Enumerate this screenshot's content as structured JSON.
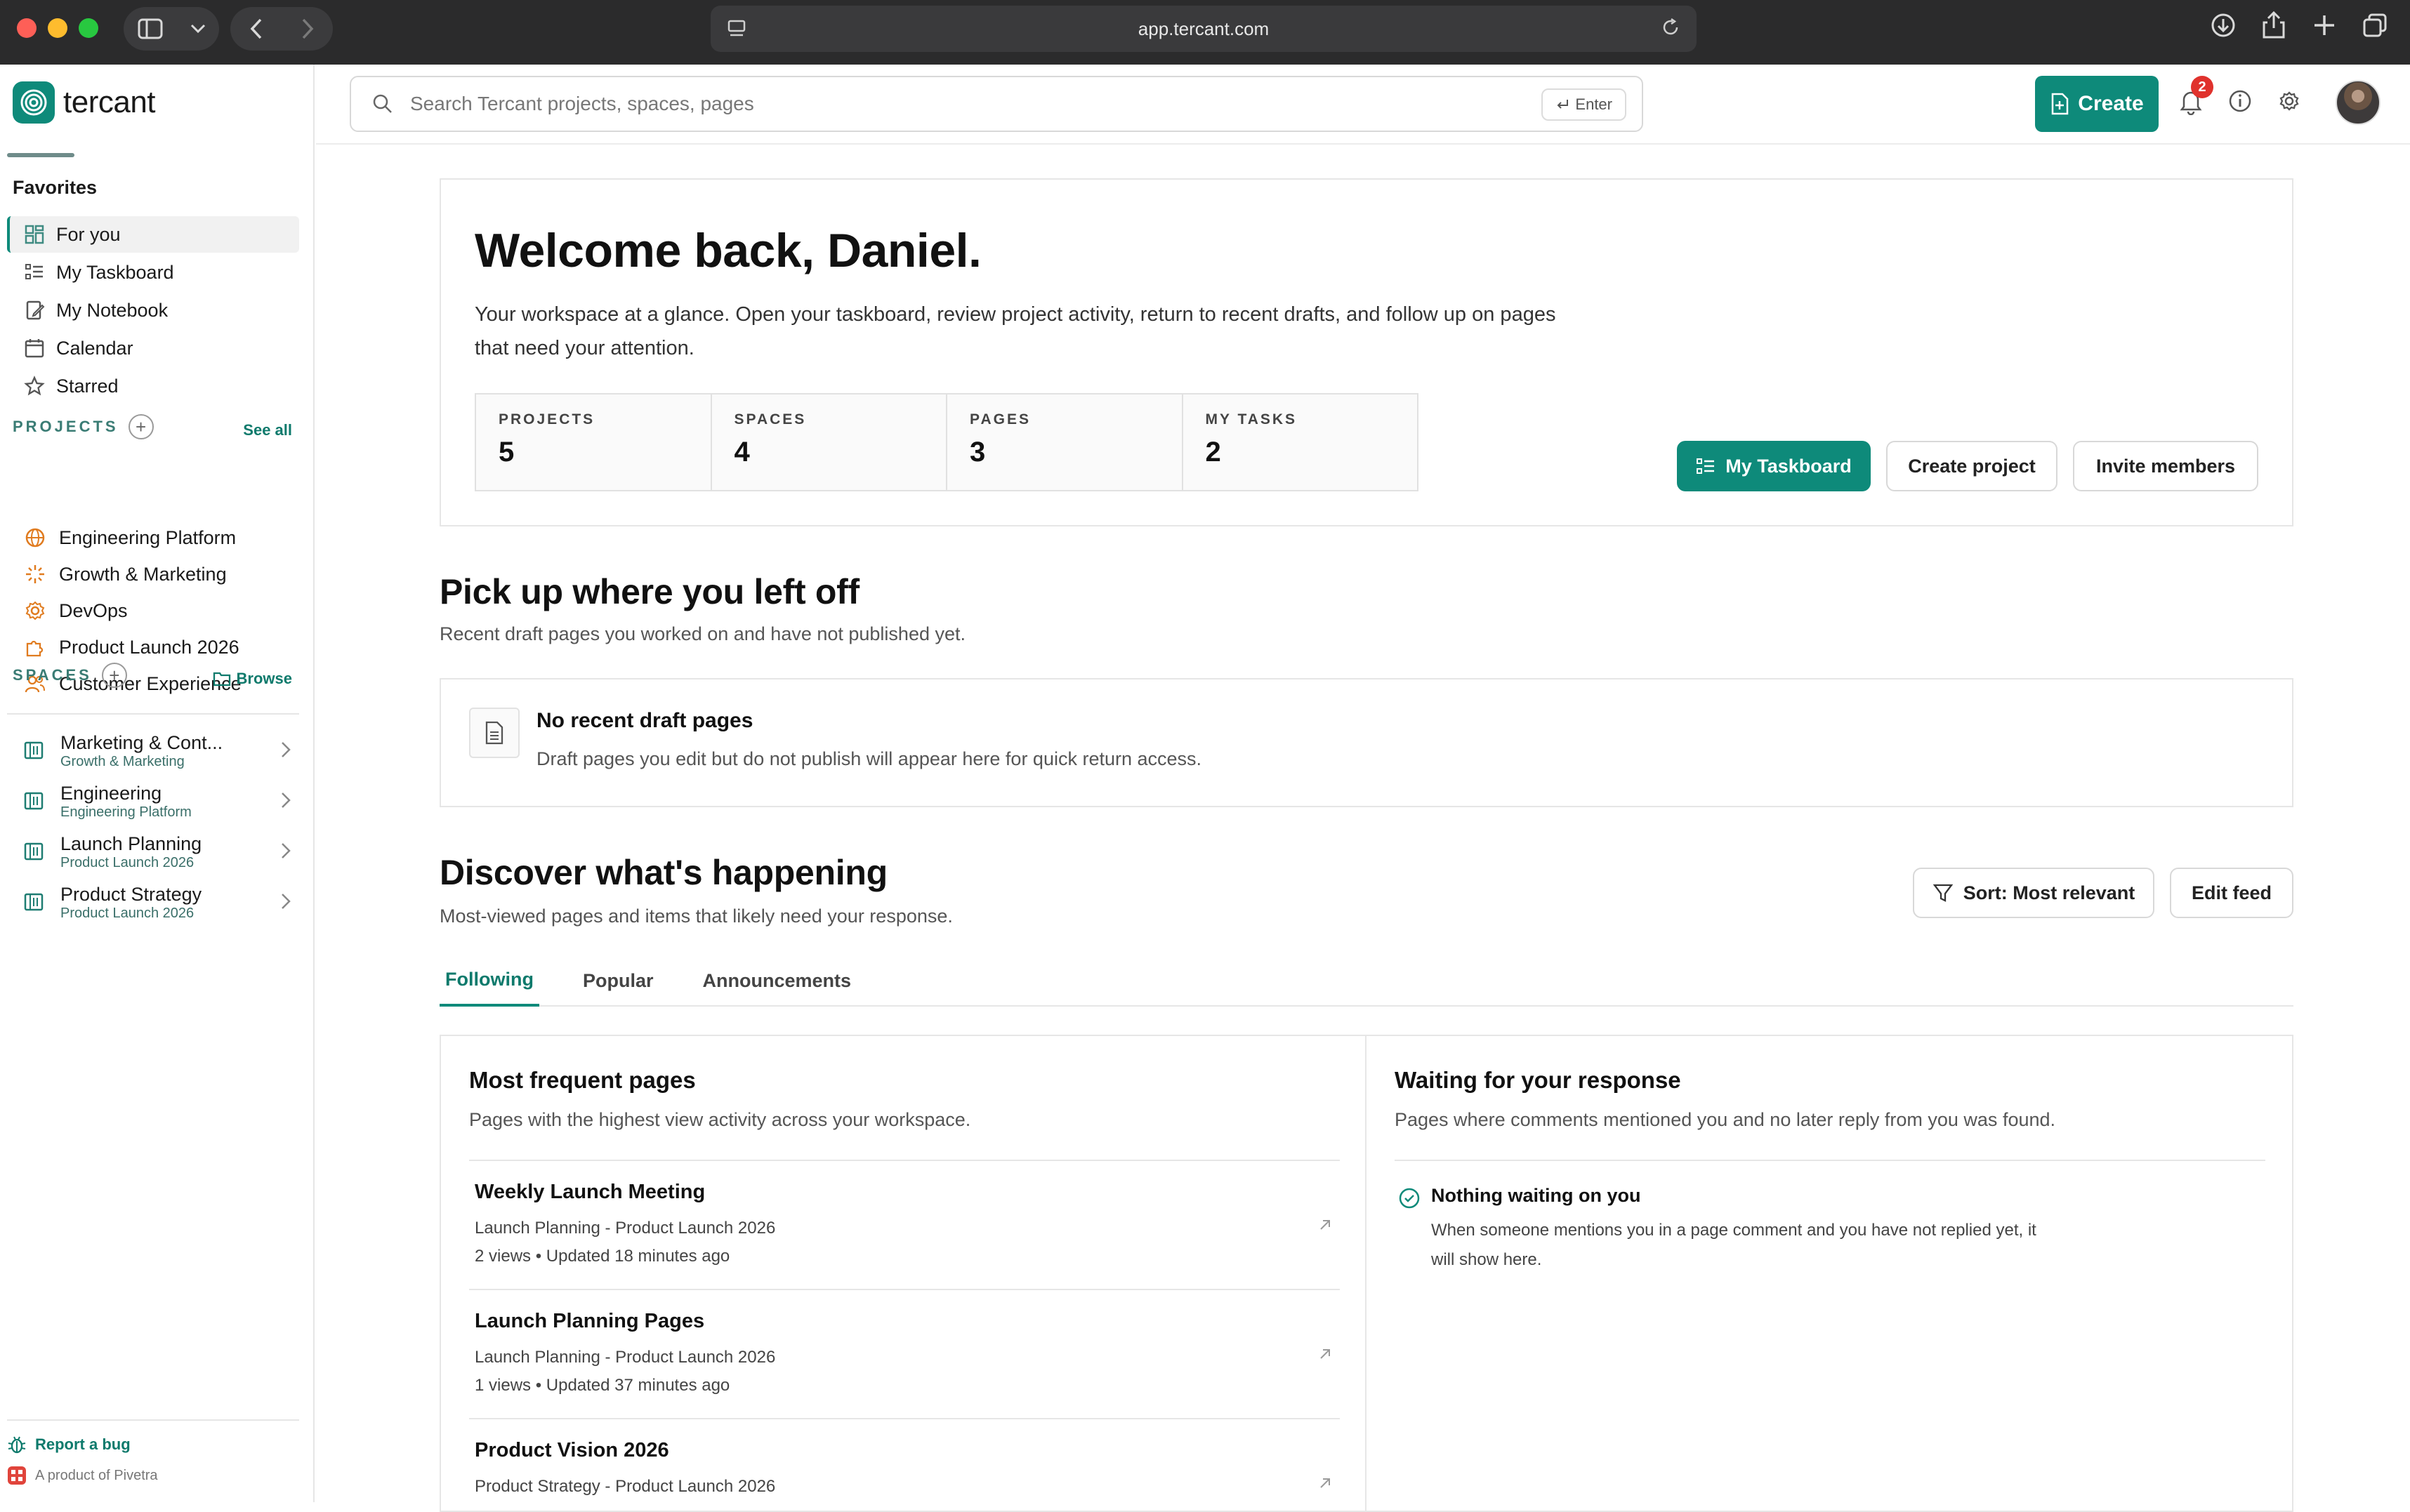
{
  "browser": {
    "url": "app.tercant.com"
  },
  "sidebar": {
    "logo": "tercant",
    "favorites_heading": "Favorites",
    "nav": [
      {
        "label": "For you",
        "icon": "grid-icon"
      },
      {
        "label": "My Taskboard",
        "icon": "taskboard-icon"
      },
      {
        "label": "My Notebook",
        "icon": "notebook-icon"
      },
      {
        "label": "Calendar",
        "icon": "calendar-icon"
      },
      {
        "label": "Starred",
        "icon": "star-icon"
      }
    ],
    "projects_label": "PROJECTS",
    "projects_link": "See all",
    "projects": [
      {
        "label": "Engineering Platform",
        "icon": "globe-icon"
      },
      {
        "label": "Growth & Marketing",
        "icon": "sparkle-icon"
      },
      {
        "label": "DevOps",
        "icon": "gear-icon"
      },
      {
        "label": "Product Launch 2026",
        "icon": "puzzle-icon"
      },
      {
        "label": "Customer Experience",
        "icon": "users-icon"
      }
    ],
    "spaces_label": "SPACES",
    "spaces_link": "Browse",
    "spaces": [
      {
        "name": "Marketing & Cont...",
        "sub": "Growth & Marketing"
      },
      {
        "name": "Engineering",
        "sub": "Engineering Platform"
      },
      {
        "name": "Launch Planning",
        "sub": "Product Launch 2026"
      },
      {
        "name": "Product Strategy",
        "sub": "Product Launch 2026"
      }
    ],
    "report_bug": "Report a bug",
    "product_of": "A product of Pivetra"
  },
  "topbar": {
    "search_placeholder": "Search Tercant projects, spaces, pages",
    "enter_label": "Enter",
    "create_label": "Create",
    "notifications_count": "2"
  },
  "welcome": {
    "title": "Welcome back, Daniel.",
    "description": "Your workspace at a glance. Open your taskboard, review project activity, return to recent drafts, and follow up on pages that need your attention.",
    "stats": [
      {
        "label": "PROJECTS",
        "value": "5"
      },
      {
        "label": "SPACES",
        "value": "4"
      },
      {
        "label": "PAGES",
        "value": "3"
      },
      {
        "label": "MY TASKS",
        "value": "2"
      }
    ],
    "btn_taskboard": "My Taskboard",
    "btn_create_project": "Create project",
    "btn_invite": "Invite members"
  },
  "drafts": {
    "title": "Pick up where you left off",
    "subtitle": "Recent draft pages you worked on and have not published yet.",
    "empty_title": "No recent draft pages",
    "empty_text": "Draft pages you edit but do not publish will appear here for quick return access."
  },
  "discover": {
    "title": "Discover what's happening",
    "subtitle": "Most-viewed pages and items that likely need your response.",
    "sort_label": "Sort: Most relevant",
    "edit_label": "Edit feed",
    "tabs": [
      "Following",
      "Popular",
      "Announcements"
    ],
    "frequent": {
      "title": "Most frequent pages",
      "subtitle": "Pages with the highest view activity across your workspace.",
      "rows": [
        {
          "title": "Weekly Launch Meeting",
          "meta": "Launch Planning - Product Launch 2026",
          "stats": "2 views • Updated 18 minutes ago"
        },
        {
          "title": "Launch Planning Pages",
          "meta": "Launch Planning - Product Launch 2026",
          "stats": "1 views • Updated 37 minutes ago"
        },
        {
          "title": "Product Vision 2026",
          "meta": "Product Strategy - Product Launch 2026",
          "stats": ""
        }
      ]
    },
    "waiting": {
      "title": "Waiting for your response",
      "subtitle": "Pages where comments mentioned you and no later reply from you was found.",
      "empty_title": "Nothing waiting on you",
      "empty_text": "When someone mentions you in a page comment and you have not replied yet, it will show here."
    }
  },
  "colors": {
    "accent": "#0e8a7a",
    "project_icon": "#e07b1f",
    "badge": "#e0322d"
  }
}
